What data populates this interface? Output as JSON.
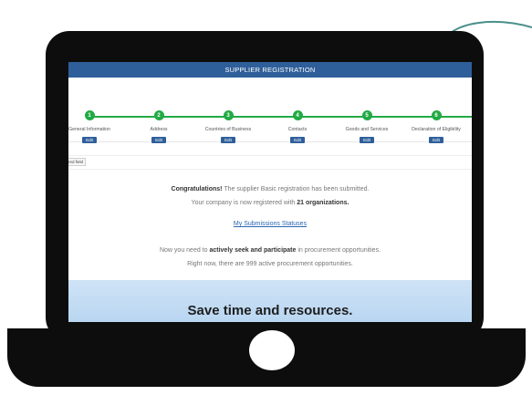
{
  "topbar": {
    "title": "SUPPLIER REGISTRATION"
  },
  "steps": [
    {
      "num": "1",
      "label": "General Information",
      "edit": "Edit"
    },
    {
      "num": "2",
      "label": "Address",
      "edit": "Edit"
    },
    {
      "num": "3",
      "label": "Countries of Business",
      "edit": "Edit"
    },
    {
      "num": "4",
      "label": "Contacts",
      "edit": "Edit"
    },
    {
      "num": "5",
      "label": "Goods and Services",
      "edit": "Edit"
    },
    {
      "num": "6",
      "label": "Declaration of Eligibility",
      "edit": "Edit"
    }
  ],
  "field": {
    "tag": "red field"
  },
  "message": {
    "congrats_bold": "Congratulations!",
    "congrats_rest": " The supplier Basic registration has been submitted.",
    "registered_prefix": "Your company is now registered with ",
    "registered_count": "21 organizations.",
    "link": "My Submissions Statuses",
    "seek_prefix": "Now you need to ",
    "seek_bold": "actively seek and participate",
    "seek_suffix": " in procurement opportunities.",
    "active_line": "Right now, there are 999 active procurement opportunities."
  },
  "banner": {
    "text": "Save time and resources."
  },
  "colors": {
    "header": "#2f5f9a",
    "step": "#22aa44",
    "link": "#2a66b3",
    "cable": "#4a8f8a"
  }
}
